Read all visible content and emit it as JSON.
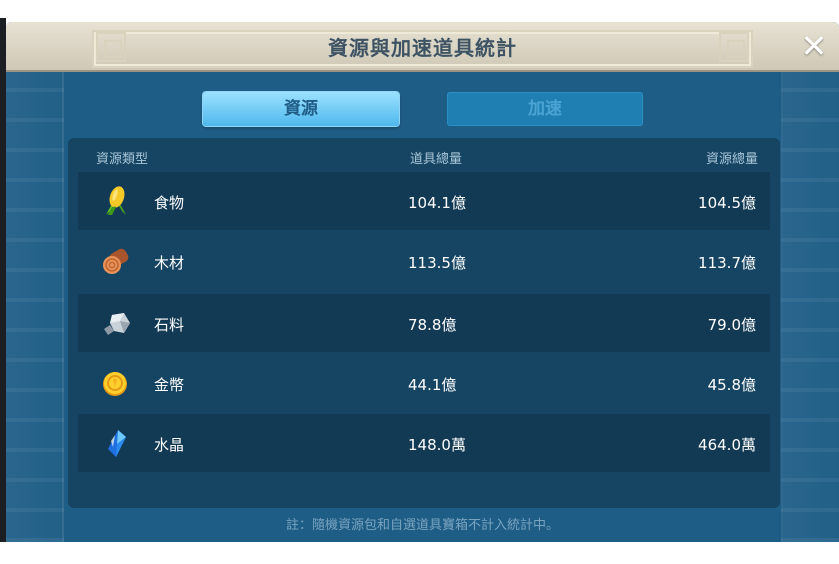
{
  "title": "資源與加速道具統計",
  "close_glyph": "✕",
  "tabs": [
    {
      "label": "資源",
      "active": true
    },
    {
      "label": "加速",
      "active": false
    }
  ],
  "columns": [
    "資源類型",
    "道具總量",
    "資源總量"
  ],
  "rows": [
    {
      "icon": "corn-icon",
      "name": "食物",
      "item_total": "104.1億",
      "resource_total": "104.5億"
    },
    {
      "icon": "wood-log-icon",
      "name": "木材",
      "item_total": "113.5億",
      "resource_total": "113.7億"
    },
    {
      "icon": "stone-icon",
      "name": "石料",
      "item_total": "78.8億",
      "resource_total": "79.0億"
    },
    {
      "icon": "gold-coin-icon",
      "name": "金幣",
      "item_total": "44.1億",
      "resource_total": "45.8億"
    },
    {
      "icon": "crystal-icon",
      "name": "水晶",
      "item_total": "148.0萬",
      "resource_total": "464.0萬"
    }
  ],
  "footer_note": "註：隨機資源包和自選道具寶箱不計入統計中。",
  "colors": {
    "panel": "#1e5d86",
    "table": "#164563",
    "tab_active": "#4fb8ec",
    "header": "#e7e2d3"
  }
}
